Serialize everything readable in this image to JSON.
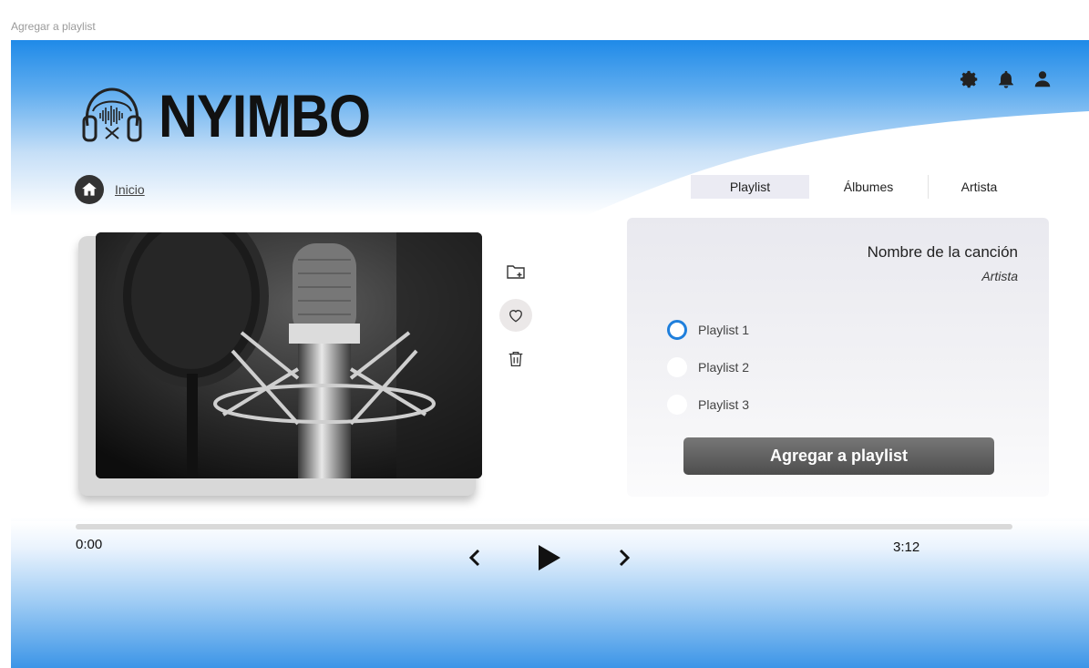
{
  "window": {
    "title": "Agregar a playlist"
  },
  "brand": {
    "name": "NYIMBO",
    "logo_icon": "headphones-soundwave-icon"
  },
  "header": {
    "icons": [
      "gear-icon",
      "bell-icon",
      "user-icon"
    ]
  },
  "breadcrumb": {
    "home_icon": "home-icon",
    "label": "Inicio"
  },
  "tabs": [
    {
      "label": "Playlist",
      "active": true
    },
    {
      "label": "Álbumes",
      "active": false
    },
    {
      "label": "Artista",
      "active": false
    }
  ],
  "cover": {
    "icon": "microphone-photo"
  },
  "side_actions": [
    "folder-add-icon",
    "heart-icon",
    "trash-icon"
  ],
  "panel": {
    "song_name": "Nombre de la canción",
    "artist": "Artista",
    "options": [
      {
        "label": "Playlist 1",
        "selected": true
      },
      {
        "label": "Playlist 2",
        "selected": false
      },
      {
        "label": "Playlist 3",
        "selected": false
      }
    ],
    "button_label": "Agregar a playlist"
  },
  "player": {
    "current_time": "0:00",
    "total_time": "3:12",
    "progress": 0,
    "controls": [
      "previous-icon",
      "play-icon",
      "next-icon"
    ]
  },
  "colors": {
    "accent": "#1f7fdc",
    "sky": "#2f8de6",
    "button": "#5a5a5a"
  }
}
